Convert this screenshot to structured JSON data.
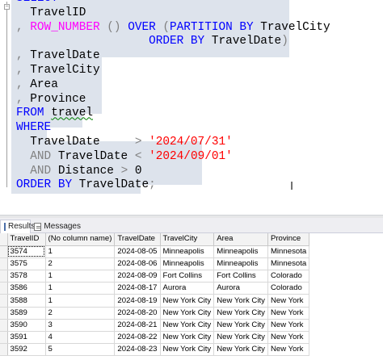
{
  "editor": {
    "lines": [
      [
        {
          "t": "SELECT",
          "c": "kw"
        }
      ],
      [
        {
          "t": "  TravelID",
          "c": ""
        }
      ],
      [
        {
          "t": ", ",
          "c": "op"
        },
        {
          "t": "ROW_NUMBER",
          "c": "fn"
        },
        {
          "t": " () ",
          "c": "op"
        },
        {
          "t": "OVER",
          "c": "kw"
        },
        {
          "t": " (",
          "c": "op"
        },
        {
          "t": "PARTITION BY",
          "c": "kw"
        },
        {
          "t": " TravelCity",
          "c": ""
        }
      ],
      [
        {
          "t": "                   ",
          "c": ""
        },
        {
          "t": "ORDER BY",
          "c": "kw"
        },
        {
          "t": " TravelDate",
          "c": ""
        },
        {
          "t": ")",
          "c": "op"
        }
      ],
      [
        {
          "t": ", ",
          "c": "op"
        },
        {
          "t": "TravelDate",
          "c": ""
        }
      ],
      [
        {
          "t": ", ",
          "c": "op"
        },
        {
          "t": "TravelCity",
          "c": ""
        }
      ],
      [
        {
          "t": ", ",
          "c": "op"
        },
        {
          "t": "Area",
          "c": ""
        }
      ],
      [
        {
          "t": ", ",
          "c": "op"
        },
        {
          "t": "Province",
          "c": ""
        }
      ],
      [
        {
          "t": "FROM",
          "c": "kw"
        },
        {
          "t": " ",
          "c": ""
        },
        {
          "t": "travel",
          "c": "sq"
        }
      ],
      [
        {
          "t": "WHERE",
          "c": "kw"
        }
      ],
      [
        {
          "t": "  TravelDate     ",
          "c": ""
        },
        {
          "t": "> ",
          "c": "op"
        },
        {
          "t": "'2024/07/31'",
          "c": "str"
        }
      ],
      [
        {
          "t": "  ",
          "c": ""
        },
        {
          "t": "AND",
          "c": "op"
        },
        {
          "t": " TravelDate ",
          "c": ""
        },
        {
          "t": "< ",
          "c": "op"
        },
        {
          "t": "'2024/09/01'",
          "c": "str"
        }
      ],
      [
        {
          "t": "  ",
          "c": ""
        },
        {
          "t": "AND",
          "c": "op"
        },
        {
          "t": " Distance ",
          "c": ""
        },
        {
          "t": "> ",
          "c": "op"
        },
        {
          "t": "0",
          "c": ""
        }
      ],
      [
        {
          "t": "ORDER BY",
          "c": "kw"
        },
        {
          "t": " TravelDate",
          "c": ""
        },
        {
          "t": ";",
          "c": "op"
        }
      ]
    ]
  },
  "tabs": {
    "results": "Results",
    "messages": "Messages"
  },
  "grid": {
    "columns": [
      "TravelID",
      "(No column name)",
      "TravelDate",
      "TravelCity",
      "Area",
      "Province"
    ],
    "rows": [
      [
        "3574",
        "1",
        "2024-08-05",
        "Minneapolis",
        "Minneapolis",
        "Minnesota"
      ],
      [
        "3575",
        "2",
        "2024-08-06",
        "Minneapolis",
        "Minneapolis",
        "Minnesota"
      ],
      [
        "3578",
        "1",
        "2024-08-09",
        "Fort Collins",
        "Fort Collins",
        "Colorado"
      ],
      [
        "3586",
        "1",
        "2024-08-17",
        "Aurora",
        "Aurora",
        "Colorado"
      ],
      [
        "3588",
        "1",
        "2024-08-19",
        "New York City",
        "New York City",
        "New York"
      ],
      [
        "3589",
        "2",
        "2024-08-20",
        "New York City",
        "New York City",
        "New York"
      ],
      [
        "3590",
        "3",
        "2024-08-21",
        "New York City",
        "New York City",
        "New York"
      ],
      [
        "3591",
        "4",
        "2024-08-22",
        "New York City",
        "New York City",
        "New York"
      ],
      [
        "3592",
        "5",
        "2024-08-23",
        "New York City",
        "New York City",
        "New York"
      ]
    ]
  },
  "colors": {
    "keyword": "#0000ff",
    "function": "#ff00ff",
    "operator": "#808080",
    "string": "#ff0000",
    "selection": "#dde3ec"
  },
  "icons": [
    "fold-collapse-icon",
    "text-cursor-icon",
    "results-grid-icon",
    "messages-icon"
  ]
}
